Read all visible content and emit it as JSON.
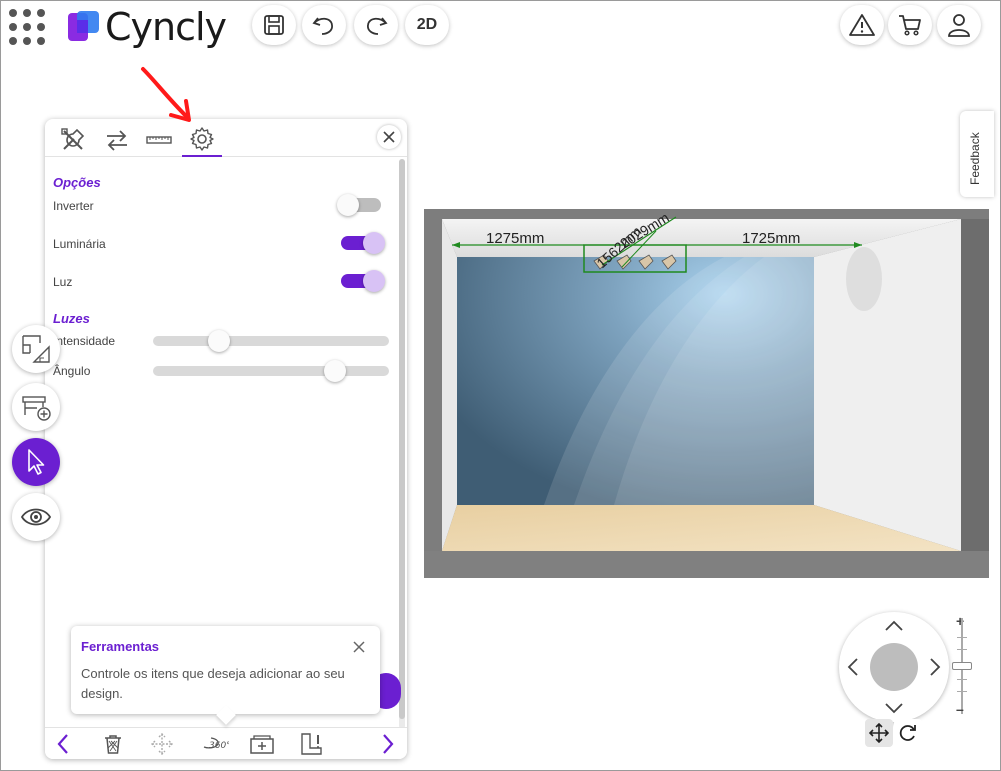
{
  "app": {
    "brand": "Cyncly"
  },
  "toolbar": {
    "view_mode_label": "2D"
  },
  "panel": {
    "tabs": [
      {
        "icon": "tools-icon"
      },
      {
        "icon": "swap-arrows-icon"
      },
      {
        "icon": "ruler-icon"
      },
      {
        "icon": "gear-icon",
        "active": true
      }
    ],
    "options_title": "Opções",
    "options": [
      {
        "label": "Inverter",
        "on": false
      },
      {
        "label": "Luminária",
        "on": true
      },
      {
        "label": "Luz",
        "on": true
      }
    ],
    "lights_title": "Luzes",
    "sliders": [
      {
        "label": "Intensidade",
        "value_fraction": 0.28
      },
      {
        "label": "Ângulo",
        "value_fraction": 0.77
      }
    ]
  },
  "tooltip": {
    "title": "Ferramentas",
    "body": "Controle os itens que deseja adicionar ao seu design."
  },
  "viewport": {
    "dimensions": [
      "1275mm",
      "1725mm",
      "1562mm",
      "2029mm"
    ]
  },
  "feedback": {
    "label": "Feedback"
  },
  "bottom_bar": {
    "icons": [
      "prev-arrow-icon",
      "trash-icon",
      "move-icon",
      "rotate-360-icon",
      "add-frame-icon",
      "warning-item-icon",
      "next-arrow-icon"
    ],
    "rotate_label": "360°"
  },
  "colors": {
    "accent": "#6b1fd1",
    "wall": "#4a6b84",
    "floor": "#e9d3a6"
  }
}
